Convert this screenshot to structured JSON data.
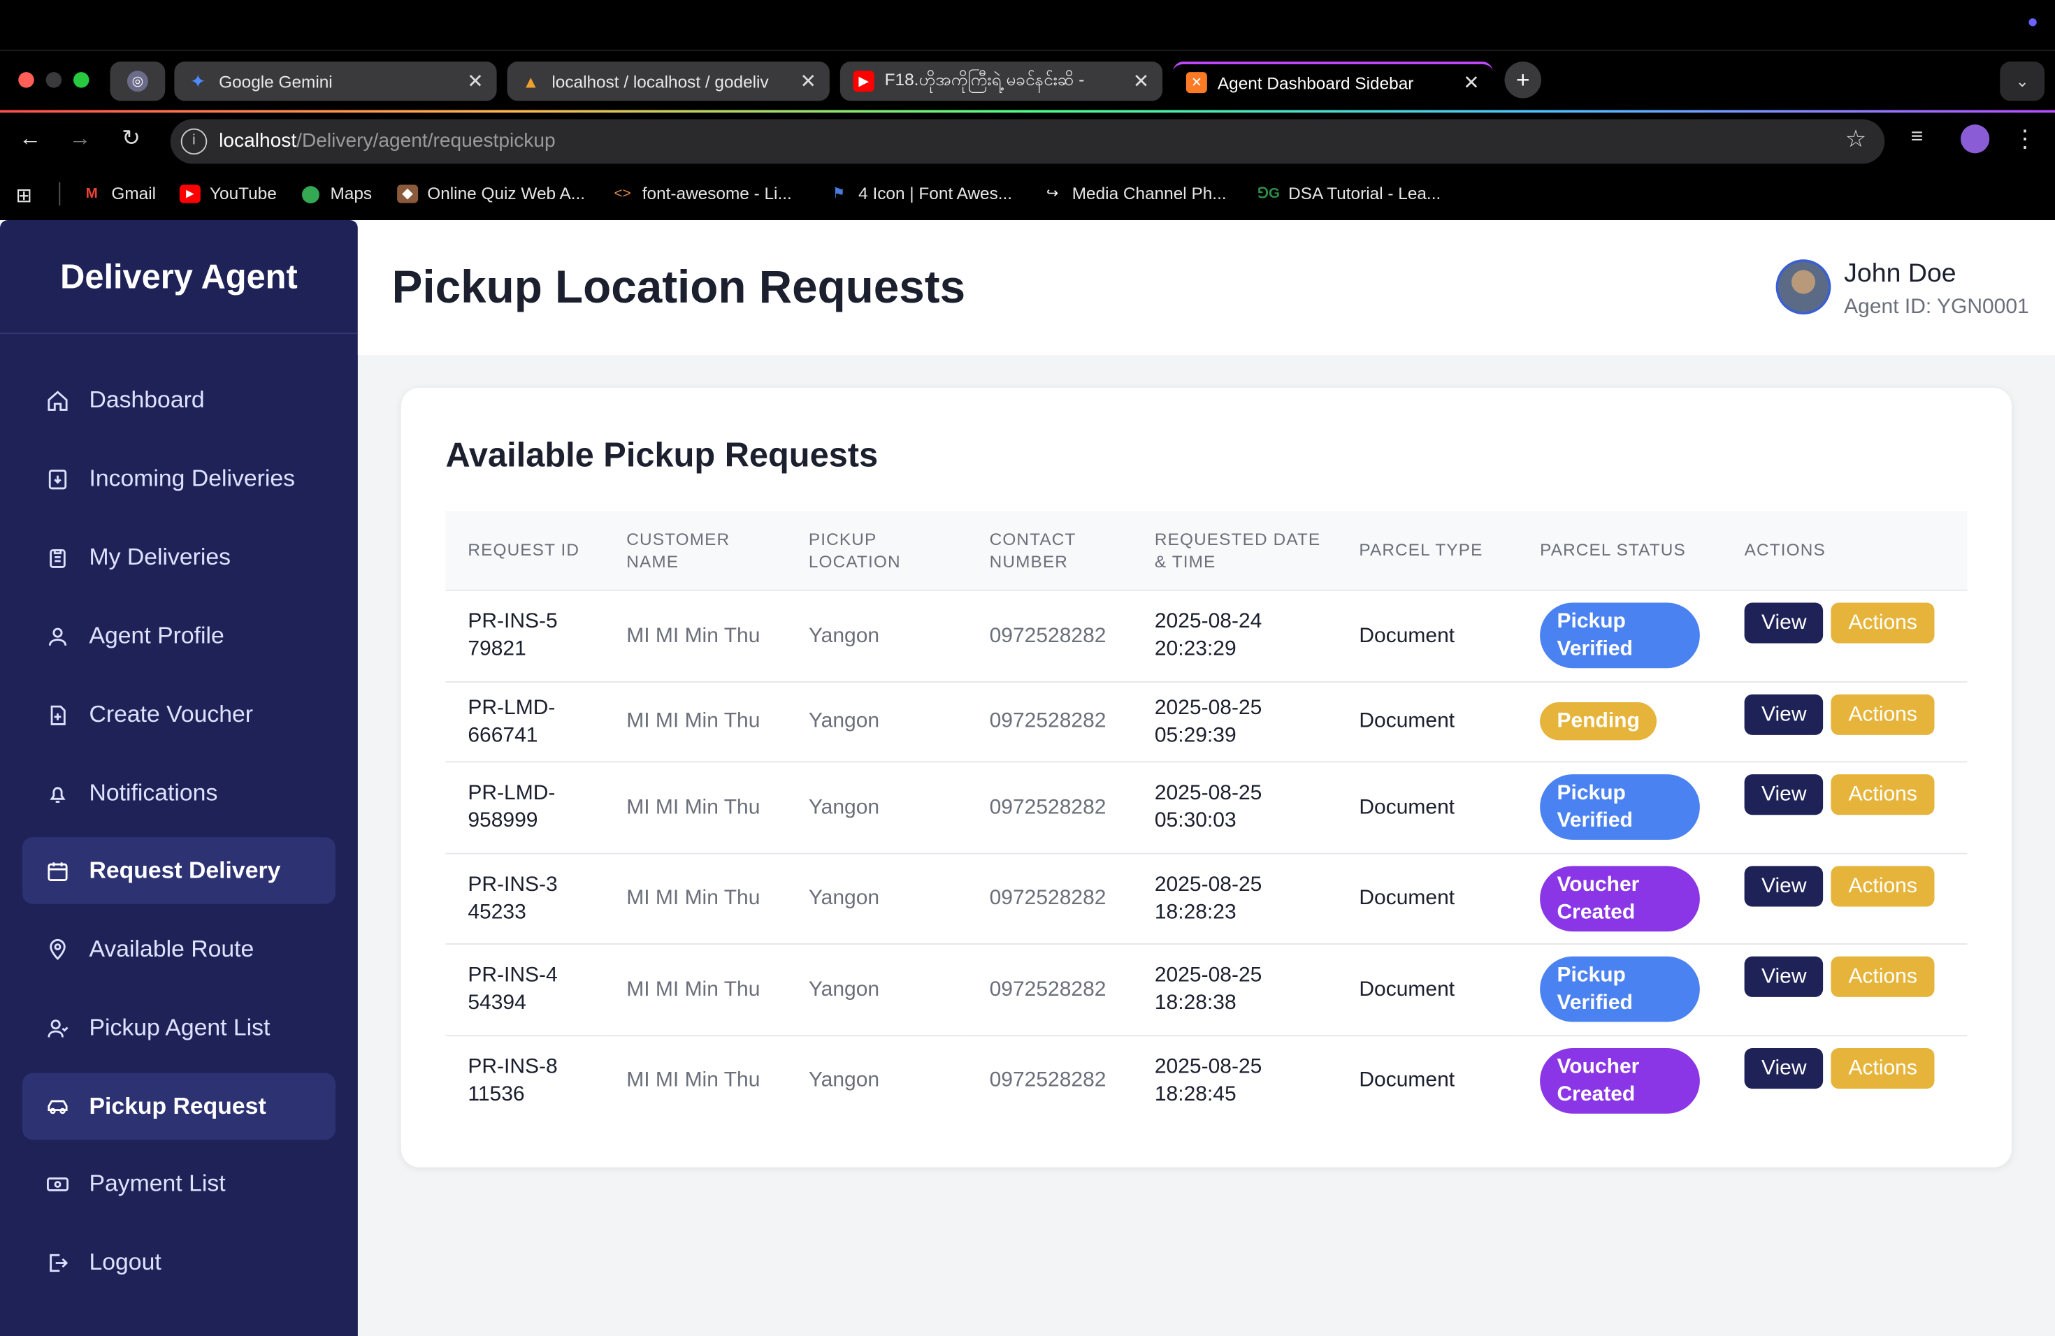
{
  "browser": {
    "tabs": [
      {
        "title": "Google Gemini",
        "favicon": "gemini-icon"
      },
      {
        "title": "localhost / localhost / godeliv",
        "favicon": "phpmyadmin-icon"
      },
      {
        "title": "F18.ဟိုအကိုကြီးရဲ့ မခင်နင်းဆိ -",
        "favicon": "youtube-icon"
      },
      {
        "title": "Agent Dashboard Sidebar",
        "favicon": "xampp-icon"
      }
    ],
    "url_host": "localhost",
    "url_path": "/Delivery/agent/requestpickup",
    "bookmarks": [
      {
        "label": "Gmail",
        "icon": "gmail-icon"
      },
      {
        "label": "YouTube",
        "icon": "youtube-icon"
      },
      {
        "label": "Maps",
        "icon": "maps-icon"
      },
      {
        "label": "Online Quiz Web A...",
        "icon": "quiz-icon"
      },
      {
        "label": "font-awesome - Li...",
        "icon": "code-icon"
      },
      {
        "label": "4 Icon | Font Awes...",
        "icon": "flag-icon"
      },
      {
        "label": "Media Channel Ph...",
        "icon": "media-icon"
      },
      {
        "label": "DSA Tutorial - Lea...",
        "icon": "gfg-icon"
      }
    ]
  },
  "sidebar": {
    "brand": "Delivery Agent",
    "items": [
      {
        "label": "Dashboard",
        "icon": "home-icon"
      },
      {
        "label": "Incoming Deliveries",
        "icon": "inbox-download-icon"
      },
      {
        "label": "My Deliveries",
        "icon": "clipboard-icon"
      },
      {
        "label": "Agent Profile",
        "icon": "user-icon"
      },
      {
        "label": "Create Voucher",
        "icon": "file-plus-icon"
      },
      {
        "label": "Notifications",
        "icon": "bell-icon"
      },
      {
        "label": "Request Delivery",
        "icon": "calendar-icon",
        "active": true
      },
      {
        "label": "Available Route",
        "icon": "map-pin-icon"
      },
      {
        "label": "Pickup Agent List",
        "icon": "users-icon"
      },
      {
        "label": "Pickup Request",
        "icon": "car-icon",
        "active": true
      },
      {
        "label": "Payment List",
        "icon": "cash-icon"
      },
      {
        "label": "Logout",
        "icon": "logout-icon"
      }
    ]
  },
  "header": {
    "title": "Pickup Location Requests",
    "user_name": "John Doe",
    "agent_id": "Agent ID: YGN0001"
  },
  "card": {
    "title": "Available Pickup Requests",
    "columns": [
      "REQUEST ID",
      "CUSTOMER NAME",
      "PICKUP LOCATION",
      "CONTACT NUMBER",
      "REQUESTED DATE & TIME",
      "PARCEL TYPE",
      "PARCEL STATUS",
      "ACTIONS"
    ],
    "rows": [
      {
        "id": "PR-INS-579821",
        "customer": "MI MI Min Thu",
        "location": "Yangon",
        "contact": "0972528282",
        "datetime": "2025-08-24 20:23:29",
        "type": "Document",
        "status": "Pickup Verified"
      },
      {
        "id": "PR-LMD-666741",
        "customer": "MI MI Min Thu",
        "location": "Yangon",
        "contact": "0972528282",
        "datetime": "2025-08-25 05:29:39",
        "type": "Document",
        "status": "Pending"
      },
      {
        "id": "PR-LMD-958999",
        "customer": "MI MI Min Thu",
        "location": "Yangon",
        "contact": "0972528282",
        "datetime": "2025-08-25 05:30:03",
        "type": "Document",
        "status": "Pickup Verified"
      },
      {
        "id": "PR-INS-345233",
        "customer": "MI MI Min Thu",
        "location": "Yangon",
        "contact": "0972528282",
        "datetime": "2025-08-25 18:28:23",
        "type": "Document",
        "status": "Voucher Created"
      },
      {
        "id": "PR-INS-454394",
        "customer": "MI MI Min Thu",
        "location": "Yangon",
        "contact": "0972528282",
        "datetime": "2025-08-25 18:28:38",
        "type": "Document",
        "status": "Pickup Verified"
      },
      {
        "id": "PR-INS-811536",
        "customer": "MI MI Min Thu",
        "location": "Yangon",
        "contact": "0972528282",
        "datetime": "2025-08-25 18:28:45",
        "type": "Document",
        "status": "Voucher Created"
      }
    ],
    "view_label": "View",
    "actions_label": "Actions"
  },
  "colors": {
    "sidebar_bg": "#1e2257",
    "status_pickup_verified": "#4b82f1",
    "status_pending": "#e6b43a",
    "status_voucher_created": "#8a35e6",
    "view_button": "#1e2257",
    "actions_button": "#e6b43a"
  }
}
